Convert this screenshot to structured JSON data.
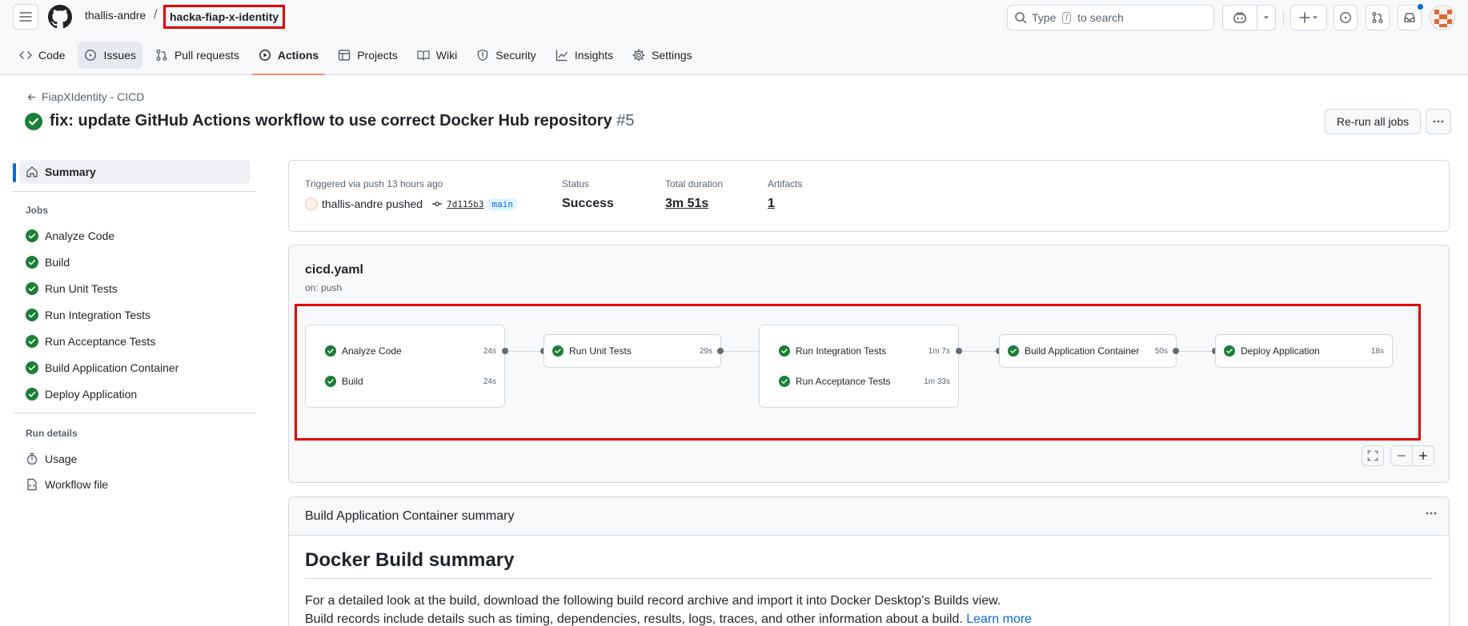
{
  "header": {
    "owner": "thallis-andre",
    "separator": "/",
    "repo": "hacka-fiap-x-identity",
    "search_prefix": "Type",
    "search_key": "/",
    "search_suffix": "to search"
  },
  "tabs": [
    {
      "label": "Code",
      "icon": "code-icon"
    },
    {
      "label": "Issues",
      "icon": "issue-icon"
    },
    {
      "label": "Pull requests",
      "icon": "pull-request-icon"
    },
    {
      "label": "Actions",
      "icon": "play-icon",
      "selected": true
    },
    {
      "label": "Projects",
      "icon": "table-icon"
    },
    {
      "label": "Wiki",
      "icon": "book-icon"
    },
    {
      "label": "Security",
      "icon": "shield-icon"
    },
    {
      "label": "Insights",
      "icon": "graph-icon"
    },
    {
      "label": "Settings",
      "icon": "gear-icon"
    }
  ],
  "run": {
    "back_label": "FiapXIdentity - CICD",
    "title": "fix: update GitHub Actions workflow to use correct Docker Hub repository",
    "number": "#5",
    "rerun_label": "Re-run all jobs"
  },
  "sidebar": {
    "summary_label": "Summary",
    "jobs_heading": "Jobs",
    "jobs": [
      "Analyze Code",
      "Build",
      "Run Unit Tests",
      "Run Integration Tests",
      "Run Acceptance Tests",
      "Build Application Container",
      "Deploy Application"
    ],
    "run_details_heading": "Run details",
    "usage_label": "Usage",
    "workflow_file_label": "Workflow file"
  },
  "summary": {
    "trigger": "Triggered via push 13 hours ago",
    "pusher": "thallis-andre pushed",
    "sha": "7d115b3",
    "branch": "main",
    "status_label": "Status",
    "status_value": "Success",
    "duration_label": "Total duration",
    "duration_value": "3m 51s",
    "artifacts_label": "Artifacts",
    "artifacts_value": "1"
  },
  "graph": {
    "file": "cicd.yaml",
    "trigger": "on: push",
    "stages": [
      [
        {
          "name": "Analyze Code",
          "duration": "24s"
        },
        {
          "name": "Build",
          "duration": "24s"
        }
      ],
      [
        {
          "name": "Run Unit Tests",
          "duration": "29s"
        }
      ],
      [
        {
          "name": "Run Integration Tests",
          "duration": "1m 7s"
        },
        {
          "name": "Run Acceptance Tests",
          "duration": "1m 33s"
        }
      ],
      [
        {
          "name": "Build Application Container",
          "duration": "50s"
        }
      ],
      [
        {
          "name": "Deploy Application",
          "duration": "18s"
        }
      ]
    ]
  },
  "build_summary": {
    "header": "Build Application Container summary",
    "heading": "Docker Build summary",
    "p1": "For a detailed look at the build, download the following build record archive and import it into Docker Desktop's Builds view.",
    "p2": "Build records include details such as timing, dependencies, results, logs, traces, and other information about a build.",
    "learn_more": "Learn more"
  },
  "colors": {
    "success": "#1a7f37",
    "accent": "#0969da",
    "highlight": "#e00000",
    "tab_underline": "#fd8c73"
  }
}
